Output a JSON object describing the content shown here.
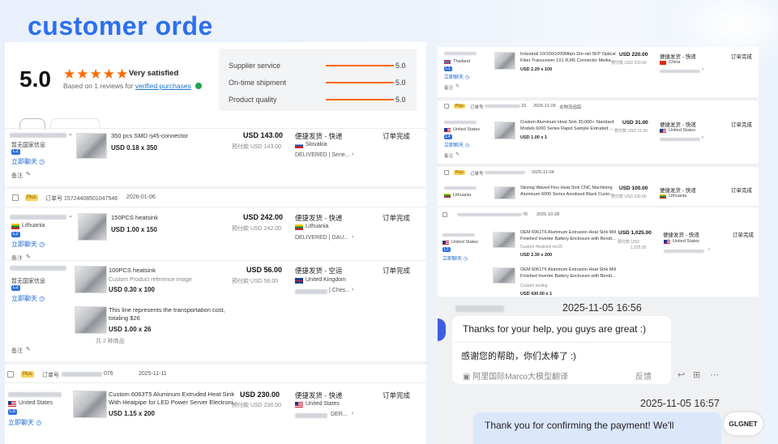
{
  "banner": {
    "title": "customer orde"
  },
  "rating": {
    "score": "5.0",
    "stars": "★★★★★",
    "summary": "Very satisfied",
    "based_on": "Based on 1 reviews for",
    "verified_link": "verified purchases",
    "criteria": [
      {
        "label": "Supplier service",
        "value": "5.0"
      },
      {
        "label": "On-time shipment",
        "value": "5.0"
      },
      {
        "label": "Product quality",
        "value": "5.0"
      }
    ]
  },
  "left_orders": {
    "o1": {
      "country_blur": "暂无国家信息",
      "level": "L2",
      "chat": "立即聊天",
      "note": "备注",
      "product": "350 pcs SMD rj45-connector",
      "unit": "USD 0.18 x 350",
      "price": "USD 143.00",
      "estimated": "预付款 USD 143.00",
      "shipping": "便捷发货 - 快递",
      "country": "Slovakia",
      "delivery": "DELIVERED | Sene...",
      "status": "订单完成"
    },
    "o2_header": {
      "plus": "Plus",
      "order_no": "订单号 15724408501047546",
      "date": "2026-01-06"
    },
    "o2": {
      "country": "Lithuania",
      "level": "L2",
      "chat": "立即聊天",
      "note": "备注",
      "product": "150PCS heatsink",
      "unit": "USD 1.00 x 150",
      "price": "USD 242.00",
      "estimated": "预付款 USD 242.00",
      "shipping": "便捷发货 - 快递",
      "ship_country": "Lithuania",
      "delivery": "DELIVERED | DAU...",
      "status": "订单完成"
    },
    "o3": {
      "country_blur": "暂无国家信息",
      "level": "L2",
      "chat": "立即聊天",
      "note": "备注",
      "product": "100PCS heatsink",
      "product_sub": "Custom Product reference image",
      "unit": "USD 0.30 x 100",
      "product2": "This line represents the transportation cost,",
      "product2_line2": "totaling $26",
      "unit2": "USD 1.00 x 26",
      "total_items": "共 2 种商品",
      "price": "USD 56.00",
      "estimated": "预付款 USD 56.00",
      "shipping": "便捷发货 - 空运",
      "ship_country": "United Kingdom",
      "delivery": "| Ches...",
      "status": "订单完成"
    },
    "o4_header": {
      "plus": "Plus",
      "order_no": "订单号",
      "order_tail": "076",
      "date": "2025-11-11"
    },
    "o4": {
      "country": "United States",
      "level": "L3",
      "chat": "立即聊天",
      "product": "Custom 6063T5 Aluminum Extruded Heat Sink",
      "product_line2": "With Heatpipe for LED Power Server Electroni...",
      "unit": "USD 1.15 x 200",
      "price": "USD 230.00",
      "estimated": "预付款 USD 230.00",
      "shipping": "便捷发货 - 快递",
      "ship_country": "United States",
      "delivery": "DER...",
      "status": "订单完成"
    }
  },
  "right_orders": {
    "r1": {
      "country": "Thailand",
      "level": "L1",
      "chat": "立即聊天",
      "note": "备注",
      "product": "Industrial 10/100/1000Mbps Din-rail SFP Optical",
      "product_line2": "Fiber Transceiver 1X1 RJ45 Connector Media ...",
      "unit": "USD 2.20 x 100",
      "price": "USD 220.00",
      "estimated": "预付款 USD 220.00",
      "shipping": "便捷发货 - 快递",
      "ship_country": "China",
      "status": "订单完成"
    },
    "r2_header": {
      "plus": "Plus",
      "order_no": "订单号",
      "order_tail": "23",
      "date": "2025-11-09",
      "tag": "去物流追踪"
    },
    "r2": {
      "country": "United States",
      "level": "L4",
      "chat": "立即聊天",
      "note": "备注",
      "product": "Custom Aluminum Heat Sink 30,000+ Standard",
      "product_line2": "Models 6000 Series Rapid Sample Extruded ...",
      "unit": "USD 1.00 x 1",
      "price": "USD 31.00",
      "estimated": "预付款 USD 31.00",
      "shipping": "便捷发货 - 快递",
      "ship_country": "United States",
      "status": "订单完成"
    },
    "r3_header": {
      "plus": "Plus",
      "order_no": "订单号",
      "date": "2025-11-04"
    },
    "r3": {
      "country": "Lithuania",
      "product": "Skiving Waved Fins Heat Sink CNC Machining",
      "product_line2": "Aluminum 6000 Series Anodized Black Custo...",
      "price": "USD 100.00",
      "estimated": "预付款 USD 100.00",
      "shipping": "便捷发货 - 快递",
      "ship_country": "Lithuania",
      "status": "订单完成"
    },
    "r4_header": {
      "order_tail": "76",
      "date": "2025-10-28"
    },
    "r4": {
      "country": "United States",
      "level": "L1",
      "chat": "立即聊天",
      "product": "OEM 6061T6 Aluminum Extrusion Heat Sink Mill",
      "product_line2": "Finished Inverter Battery Enclosure with Bendi...",
      "product_sub": "Custom Heatsink rev15",
      "unit": "USD 2.30 x 200",
      "product2": "OEM 6061T6 Aluminum Extrusion Heat Sink Mill",
      "product2_line2": "Finished Inverter Battery Enclosure with Bendi...",
      "product2_sub": "Custom tooling",
      "unit2": "USD 430.00 x 1",
      "price": "USD 1,025.00",
      "estimated": "预付款 USD",
      "estimated2": "1,025.00",
      "shipping": "便捷发货 - 快递",
      "ship_country": "United States",
      "status": "订单完成"
    }
  },
  "chat": {
    "time1": "2025-11-05 16:56",
    "message1": "Thanks for your help, you guys are great :)",
    "translation1": "感谢您的帮助，你们太棒了 :)",
    "translate_source": "阿里国际Marco大模型翻译",
    "feedback": "反馈",
    "time2": "2025-11-05 16:57",
    "message2": "Thank you for confirming the payment! We'll",
    "assistant_badge": "GLGNET"
  },
  "colors": {
    "accent": "#2d6ff0",
    "star": "#ff6a00",
    "link": "#1a67d2"
  }
}
